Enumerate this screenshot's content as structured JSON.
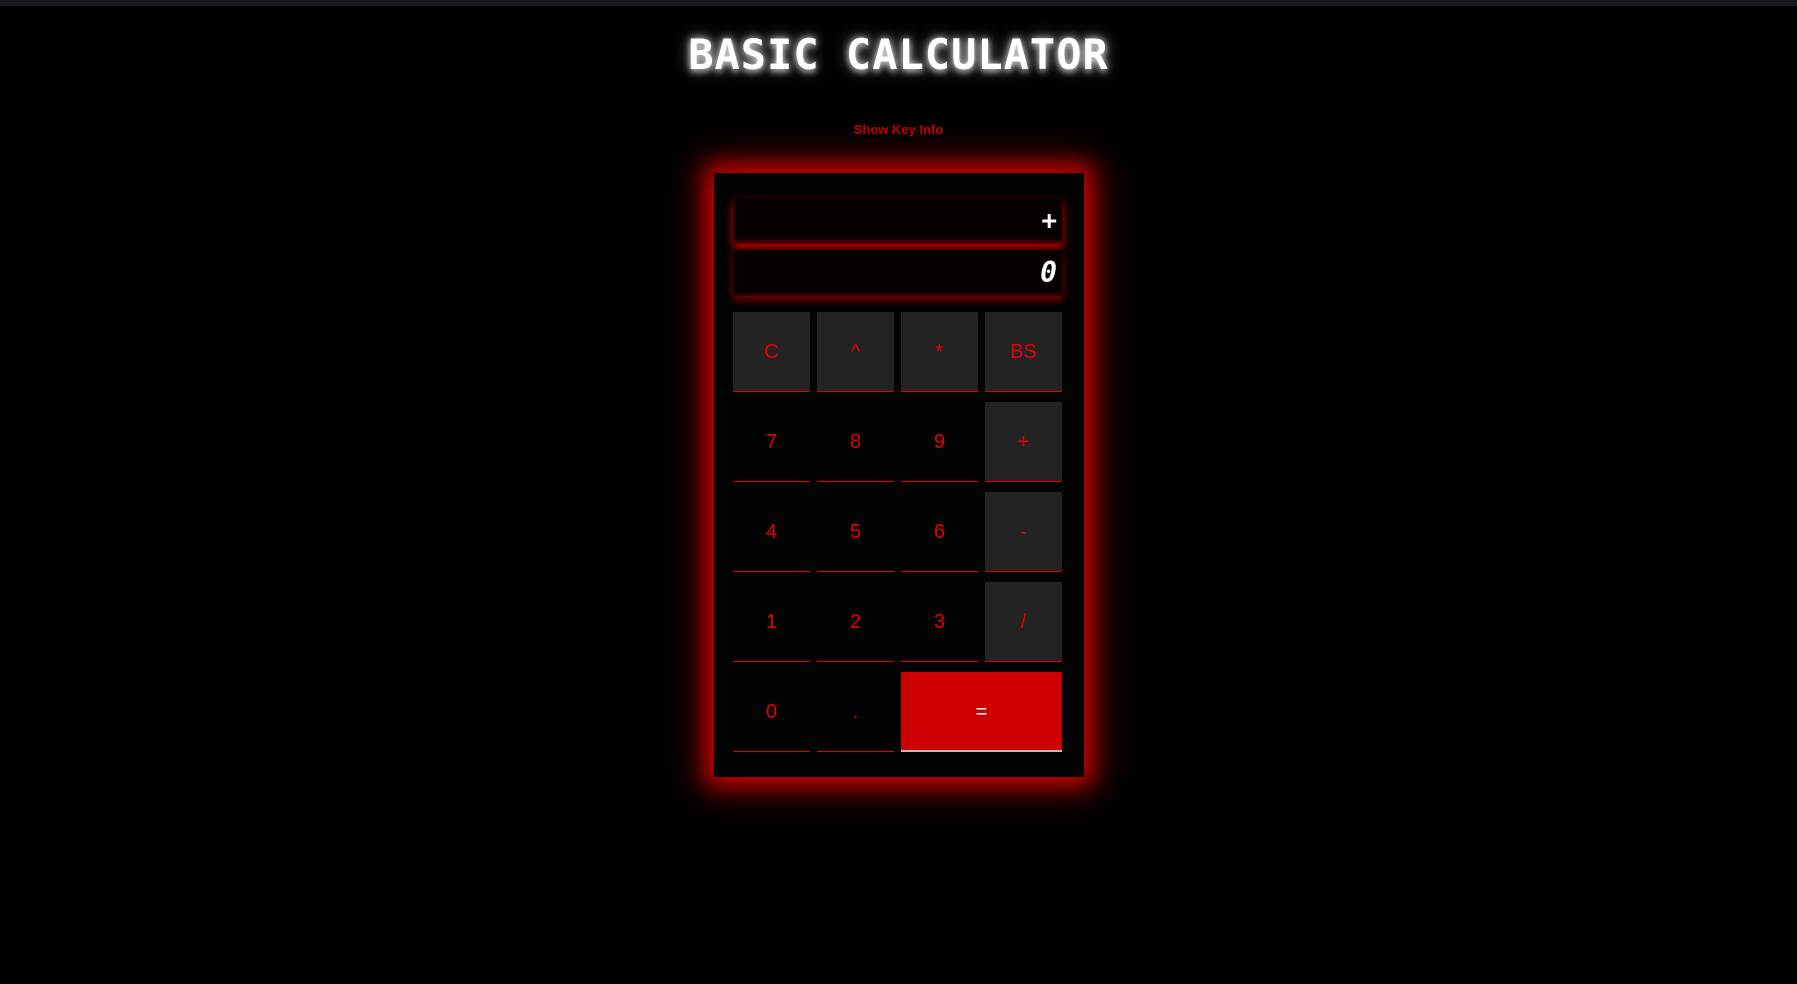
{
  "title": "BASIC CALCULATOR",
  "key_info_link": "Show Key Info",
  "display": {
    "operator": "+",
    "value": "0"
  },
  "keys": {
    "clear": "C",
    "power": "^",
    "multiply": "*",
    "backspace": "BS",
    "seven": "7",
    "eight": "8",
    "nine": "9",
    "add": "+",
    "four": "4",
    "five": "5",
    "six": "6",
    "subtract": "-",
    "one": "1",
    "two": "2",
    "three": "3",
    "divide": "/",
    "zero": "0",
    "decimal": ".",
    "equals": "="
  },
  "colors": {
    "background": "#000000",
    "accent": "#e60000",
    "equals_bg": "#cc0000",
    "operator_key_bg": "#232323"
  }
}
